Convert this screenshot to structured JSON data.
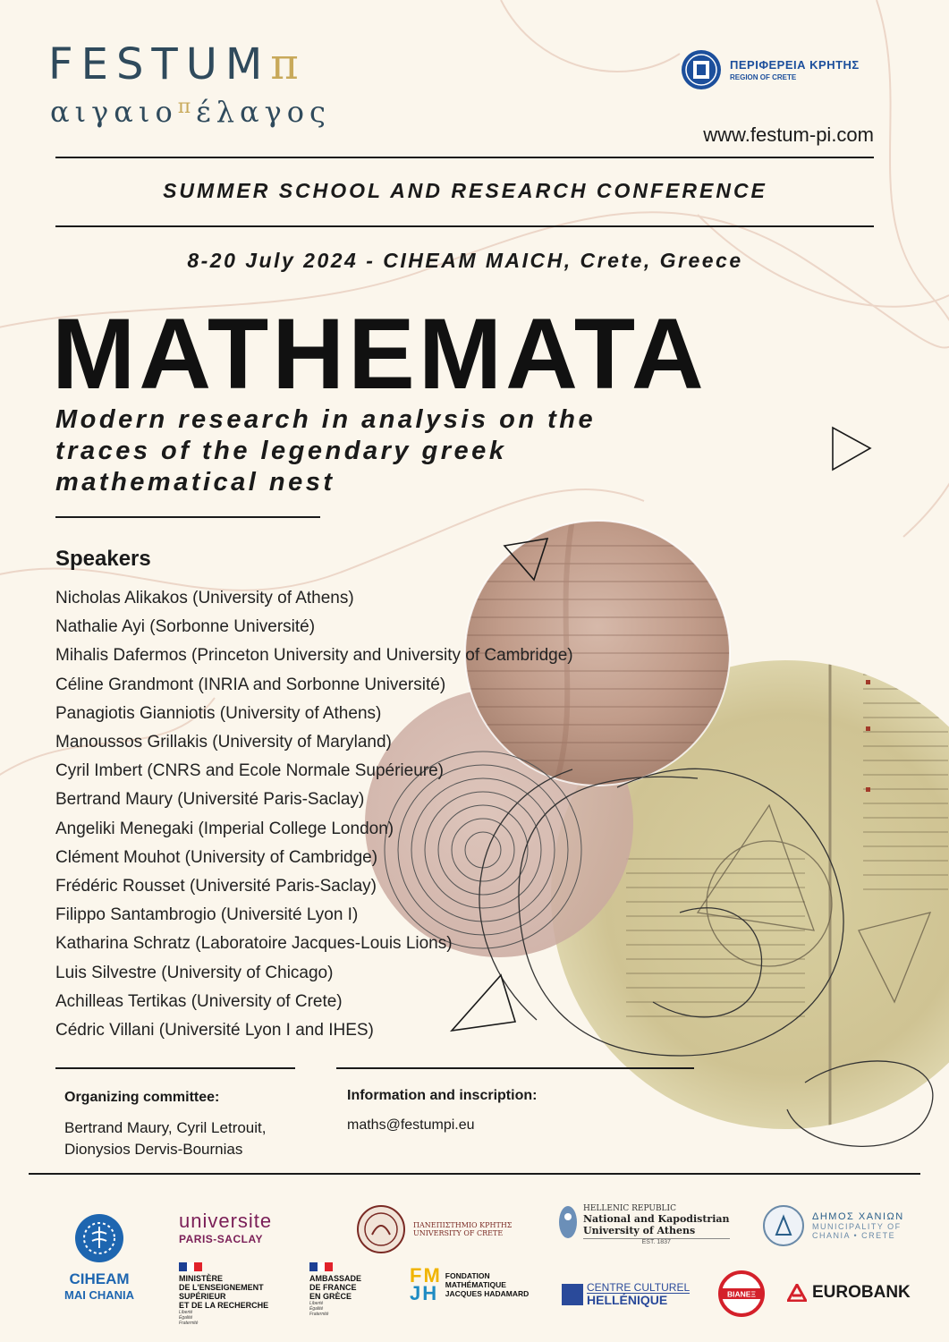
{
  "header": {
    "festum_title": "FESTUM",
    "festum_pi": "π",
    "festum_subtitle_a": "αιγαιο",
    "festum_subtitle_pi": "π",
    "festum_subtitle_b": "έλαγος",
    "region_greek": "ΠΕΡΙΦΕΡΕΙΑ ΚΡΗΤΗΣ",
    "region_english": "REGION OF CRETE",
    "website": "www.festum-pi.com"
  },
  "event": {
    "kind": "SUMMER SCHOOL AND RESEARCH CONFERENCE",
    "dates_location": "8-20 July 2024  - CIHEAM MAICH, Crete, Greece",
    "title": "MATHEMATA",
    "subtitle_lines": [
      "Modern research in analysis on the",
      "traces of the legendary greek",
      "mathematical nest"
    ]
  },
  "speakers": {
    "heading": "Speakers",
    "list": [
      "Nicholas Alikakos (University of Athens)",
      "Nathalie Ayi (Sorbonne Université)",
      "Mihalis Dafermos (Princeton University and University of Cambridge)",
      "Céline Grandmont (INRIA and Sorbonne Université)",
      "Panagiotis Gianniotis (University of Athens)",
      "Manoussos Grillakis (University of Maryland)",
      "Cyril Imbert (CNRS and Ecole Normale Supérieure)",
      "Bertrand Maury (Université Paris-Saclay)",
      "Angeliki Menegaki (Imperial College London)",
      "Clément Mouhot (University of Cambridge)",
      "Frédéric Rousset (Université Paris-Saclay)",
      "Filippo Santambrogio (Université Lyon I)",
      "Katharina Schratz (Laboratoire Jacques-Louis Lions)",
      "Luis Silvestre (University of Chicago)",
      "Achilleas Tertikas (University of Crete)",
      "Cédric Villani (Université Lyon I and IHES)"
    ]
  },
  "organizing": {
    "heading": "Organizing committee:",
    "line1": "Bertrand Maury, Cyril Letrouit,",
    "line2": "Dionysios Dervis-Bournias"
  },
  "information": {
    "heading": "Information and inscription:",
    "email": "maths@festumpi.eu"
  },
  "logos": {
    "ciheam_l1": "CIHEAM",
    "ciheam_l2": "MAI CHANIA",
    "ups_l1": "universite",
    "ups_l2": "PARIS-SACLAY",
    "uoc_gr": "ΠΑΝΕΠΙΣΤΗΜΙΟ ΚΡΗΤΗΣ",
    "uoc_en": "UNIVERSITY OF CRETE",
    "nku_hr": "HELLENIC REPUBLIC",
    "nku_n1": "National and Kapodistrian",
    "nku_n2": "University of Athens",
    "nku_est": "EST. 1837",
    "chania_c1": "ΔΗΜΟΣ ΧΑΝΙΩΝ",
    "chania_c2": "MUNICIPALITY OF",
    "chania_c3": "CHANIA • CRETE",
    "minist_lines": [
      "MINISTÈRE",
      "DE L'ENSEIGNEMENT",
      "SUPÉRIEUR",
      "ET DE LA RECHERCHE"
    ],
    "ambassade_lines": [
      "AMBASSADE",
      "DE FRANCE",
      "EN GRÈCE"
    ],
    "motto_lines": [
      "Liberté",
      "Égalité",
      "Fraternité"
    ],
    "fmjh_mark_1": "FM",
    "fmjh_mark_2": "JH",
    "fmjh_lines": [
      "FONDATION",
      "MATHÉMATIQUE",
      "JACQUES HADAMARD"
    ],
    "cch_l1": "CENTRE CULTUREL",
    "cch_l2": "HELLÉNIQUE",
    "bianes": "BIANEΞ",
    "eurobank": "EUROBANK"
  },
  "colors": {
    "background": "#fbf6ec",
    "festum_blue": "#2f4a5c",
    "festum_gold": "#c8a95a",
    "region_blue": "#1c4f9c",
    "ciheam_blue": "#1e66b0",
    "ups_purple": "#7a1e57",
    "eurobank_red": "#d4202a"
  }
}
